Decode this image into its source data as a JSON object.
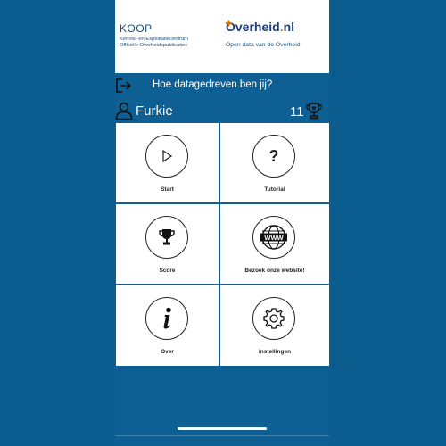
{
  "header": {
    "koop_title": "KOOP",
    "koop_line1": "Kennis- en Exploitatiecentrum",
    "koop_line2": "Officiële Overheidspublicaties",
    "overheid_logo_main": "Overheid",
    "overheid_logo_dot": ".",
    "overheid_logo_tld": "nl",
    "overheid_subtitle": "Open data van de Overheid"
  },
  "topbar": {
    "question": "Hoe datagedreven ben jij?",
    "username": "Furkie",
    "score": "11"
  },
  "tiles": [
    {
      "label": "Start",
      "icon": "play-icon"
    },
    {
      "label": "Tutorial",
      "icon": "question-mark-icon"
    },
    {
      "label": "Score",
      "icon": "trophy-icon"
    },
    {
      "label": "Bezoek onze website!",
      "icon": "www-globe-icon"
    },
    {
      "label": "Over",
      "icon": "info-icon"
    },
    {
      "label": "Instellingen",
      "icon": "gear-icon"
    }
  ],
  "colors": {
    "background": "#0c5d8f",
    "header_bg": "#ffffff",
    "accent_orange": "#e17000",
    "logo_blue": "#1b3f7a"
  }
}
